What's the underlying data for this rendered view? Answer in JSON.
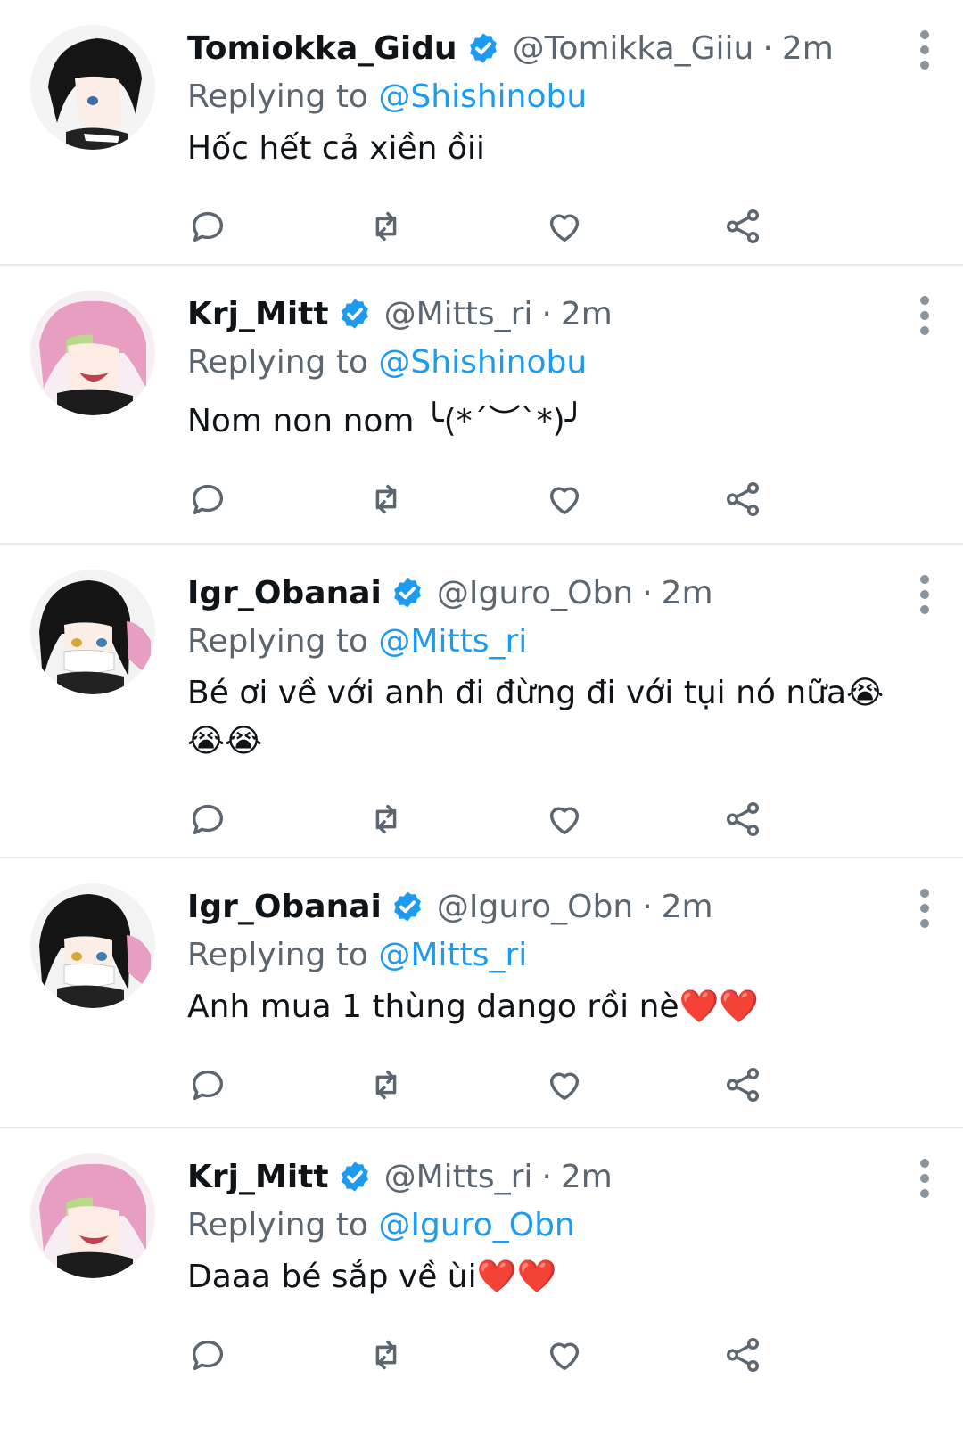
{
  "colors": {
    "accent": "#1d9bf0",
    "secondary_text": "#5b6670",
    "divider": "#e6e9ec",
    "icon": "#5b6670"
  },
  "tweets": [
    {
      "display_name": "Tomiokka_Gidu",
      "handle": "@Tomikka_Giiu",
      "separator": "·",
      "time": "2m",
      "replying_prefix": "Replying to",
      "replying_to": "@Shishinobu",
      "text": "Hốc hết cả xiền ồii",
      "avatar": "dark-haired-character-avatar"
    },
    {
      "display_name": "Krj_Mitt",
      "handle": "@Mitts_ri",
      "separator": "·",
      "time": "2m",
      "replying_prefix": "Replying to",
      "replying_to": "@Shishinobu",
      "text": "Nom non nom ╰(*´︶`*)╯",
      "avatar": "pink-haired-character-avatar"
    },
    {
      "display_name": "Igr_Obanai",
      "handle": "@Iguro_Obn",
      "separator": "·",
      "time": "2m",
      "replying_prefix": "Replying to",
      "replying_to": "@Mitts_ri",
      "text": "Bé ơi về với anh đi đừng đi với tụi nó nữa😭😭😭",
      "avatar": "masked-character-avatar"
    },
    {
      "display_name": "Igr_Obanai",
      "handle": "@Iguro_Obn",
      "separator": "·",
      "time": "2m",
      "replying_prefix": "Replying to",
      "replying_to": "@Mitts_ri",
      "text": "Anh mua 1 thùng dango rồi nè❤️❤️",
      "avatar": "masked-character-avatar"
    },
    {
      "display_name": "Krj_Mitt",
      "handle": "@Mitts_ri",
      "separator": "·",
      "time": "2m",
      "replying_prefix": "Replying to",
      "replying_to": "@Iguro_Obn",
      "text": "Daaa bé sắp về ùi❤️❤️",
      "avatar": "pink-haired-character-avatar"
    }
  ]
}
